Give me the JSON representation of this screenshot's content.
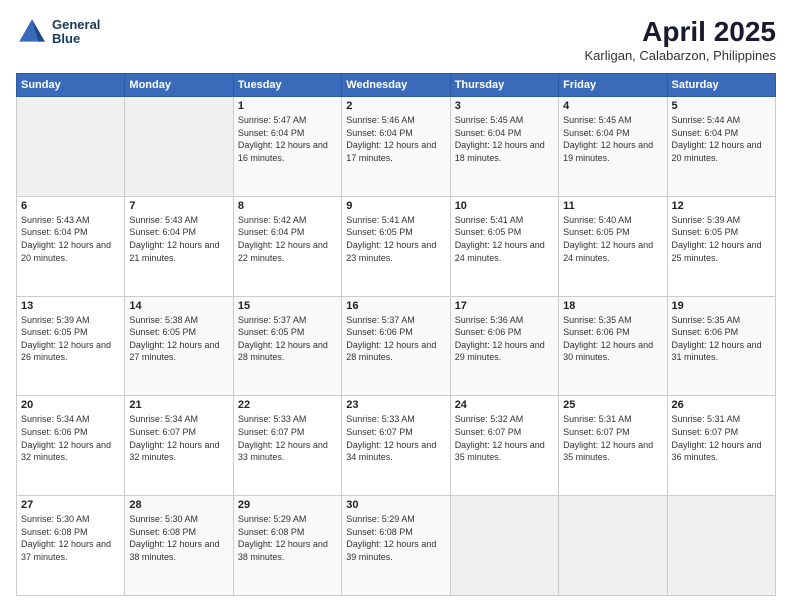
{
  "header": {
    "logo_line1": "General",
    "logo_line2": "Blue",
    "month_year": "April 2025",
    "location": "Karligan, Calabarzon, Philippines"
  },
  "days_of_week": [
    "Sunday",
    "Monday",
    "Tuesday",
    "Wednesday",
    "Thursday",
    "Friday",
    "Saturday"
  ],
  "weeks": [
    [
      {
        "num": "",
        "sunrise": "",
        "sunset": "",
        "daylight": "",
        "empty": true
      },
      {
        "num": "",
        "sunrise": "",
        "sunset": "",
        "daylight": "",
        "empty": true
      },
      {
        "num": "1",
        "sunrise": "Sunrise: 5:47 AM",
        "sunset": "Sunset: 6:04 PM",
        "daylight": "Daylight: 12 hours and 16 minutes.",
        "empty": false
      },
      {
        "num": "2",
        "sunrise": "Sunrise: 5:46 AM",
        "sunset": "Sunset: 6:04 PM",
        "daylight": "Daylight: 12 hours and 17 minutes.",
        "empty": false
      },
      {
        "num": "3",
        "sunrise": "Sunrise: 5:45 AM",
        "sunset": "Sunset: 6:04 PM",
        "daylight": "Daylight: 12 hours and 18 minutes.",
        "empty": false
      },
      {
        "num": "4",
        "sunrise": "Sunrise: 5:45 AM",
        "sunset": "Sunset: 6:04 PM",
        "daylight": "Daylight: 12 hours and 19 minutes.",
        "empty": false
      },
      {
        "num": "5",
        "sunrise": "Sunrise: 5:44 AM",
        "sunset": "Sunset: 6:04 PM",
        "daylight": "Daylight: 12 hours and 20 minutes.",
        "empty": false
      }
    ],
    [
      {
        "num": "6",
        "sunrise": "Sunrise: 5:43 AM",
        "sunset": "Sunset: 6:04 PM",
        "daylight": "Daylight: 12 hours and 20 minutes.",
        "empty": false
      },
      {
        "num": "7",
        "sunrise": "Sunrise: 5:43 AM",
        "sunset": "Sunset: 6:04 PM",
        "daylight": "Daylight: 12 hours and 21 minutes.",
        "empty": false
      },
      {
        "num": "8",
        "sunrise": "Sunrise: 5:42 AM",
        "sunset": "Sunset: 6:04 PM",
        "daylight": "Daylight: 12 hours and 22 minutes.",
        "empty": false
      },
      {
        "num": "9",
        "sunrise": "Sunrise: 5:41 AM",
        "sunset": "Sunset: 6:05 PM",
        "daylight": "Daylight: 12 hours and 23 minutes.",
        "empty": false
      },
      {
        "num": "10",
        "sunrise": "Sunrise: 5:41 AM",
        "sunset": "Sunset: 6:05 PM",
        "daylight": "Daylight: 12 hours and 24 minutes.",
        "empty": false
      },
      {
        "num": "11",
        "sunrise": "Sunrise: 5:40 AM",
        "sunset": "Sunset: 6:05 PM",
        "daylight": "Daylight: 12 hours and 24 minutes.",
        "empty": false
      },
      {
        "num": "12",
        "sunrise": "Sunrise: 5:39 AM",
        "sunset": "Sunset: 6:05 PM",
        "daylight": "Daylight: 12 hours and 25 minutes.",
        "empty": false
      }
    ],
    [
      {
        "num": "13",
        "sunrise": "Sunrise: 5:39 AM",
        "sunset": "Sunset: 6:05 PM",
        "daylight": "Daylight: 12 hours and 26 minutes.",
        "empty": false
      },
      {
        "num": "14",
        "sunrise": "Sunrise: 5:38 AM",
        "sunset": "Sunset: 6:05 PM",
        "daylight": "Daylight: 12 hours and 27 minutes.",
        "empty": false
      },
      {
        "num": "15",
        "sunrise": "Sunrise: 5:37 AM",
        "sunset": "Sunset: 6:05 PM",
        "daylight": "Daylight: 12 hours and 28 minutes.",
        "empty": false
      },
      {
        "num": "16",
        "sunrise": "Sunrise: 5:37 AM",
        "sunset": "Sunset: 6:06 PM",
        "daylight": "Daylight: 12 hours and 28 minutes.",
        "empty": false
      },
      {
        "num": "17",
        "sunrise": "Sunrise: 5:36 AM",
        "sunset": "Sunset: 6:06 PM",
        "daylight": "Daylight: 12 hours and 29 minutes.",
        "empty": false
      },
      {
        "num": "18",
        "sunrise": "Sunrise: 5:35 AM",
        "sunset": "Sunset: 6:06 PM",
        "daylight": "Daylight: 12 hours and 30 minutes.",
        "empty": false
      },
      {
        "num": "19",
        "sunrise": "Sunrise: 5:35 AM",
        "sunset": "Sunset: 6:06 PM",
        "daylight": "Daylight: 12 hours and 31 minutes.",
        "empty": false
      }
    ],
    [
      {
        "num": "20",
        "sunrise": "Sunrise: 5:34 AM",
        "sunset": "Sunset: 6:06 PM",
        "daylight": "Daylight: 12 hours and 32 minutes.",
        "empty": false
      },
      {
        "num": "21",
        "sunrise": "Sunrise: 5:34 AM",
        "sunset": "Sunset: 6:07 PM",
        "daylight": "Daylight: 12 hours and 32 minutes.",
        "empty": false
      },
      {
        "num": "22",
        "sunrise": "Sunrise: 5:33 AM",
        "sunset": "Sunset: 6:07 PM",
        "daylight": "Daylight: 12 hours and 33 minutes.",
        "empty": false
      },
      {
        "num": "23",
        "sunrise": "Sunrise: 5:33 AM",
        "sunset": "Sunset: 6:07 PM",
        "daylight": "Daylight: 12 hours and 34 minutes.",
        "empty": false
      },
      {
        "num": "24",
        "sunrise": "Sunrise: 5:32 AM",
        "sunset": "Sunset: 6:07 PM",
        "daylight": "Daylight: 12 hours and 35 minutes.",
        "empty": false
      },
      {
        "num": "25",
        "sunrise": "Sunrise: 5:31 AM",
        "sunset": "Sunset: 6:07 PM",
        "daylight": "Daylight: 12 hours and 35 minutes.",
        "empty": false
      },
      {
        "num": "26",
        "sunrise": "Sunrise: 5:31 AM",
        "sunset": "Sunset: 6:07 PM",
        "daylight": "Daylight: 12 hours and 36 minutes.",
        "empty": false
      }
    ],
    [
      {
        "num": "27",
        "sunrise": "Sunrise: 5:30 AM",
        "sunset": "Sunset: 6:08 PM",
        "daylight": "Daylight: 12 hours and 37 minutes.",
        "empty": false
      },
      {
        "num": "28",
        "sunrise": "Sunrise: 5:30 AM",
        "sunset": "Sunset: 6:08 PM",
        "daylight": "Daylight: 12 hours and 38 minutes.",
        "empty": false
      },
      {
        "num": "29",
        "sunrise": "Sunrise: 5:29 AM",
        "sunset": "Sunset: 6:08 PM",
        "daylight": "Daylight: 12 hours and 38 minutes.",
        "empty": false
      },
      {
        "num": "30",
        "sunrise": "Sunrise: 5:29 AM",
        "sunset": "Sunset: 6:08 PM",
        "daylight": "Daylight: 12 hours and 39 minutes.",
        "empty": false
      },
      {
        "num": "",
        "sunrise": "",
        "sunset": "",
        "daylight": "",
        "empty": true
      },
      {
        "num": "",
        "sunrise": "",
        "sunset": "",
        "daylight": "",
        "empty": true
      },
      {
        "num": "",
        "sunrise": "",
        "sunset": "",
        "daylight": "",
        "empty": true
      }
    ]
  ]
}
